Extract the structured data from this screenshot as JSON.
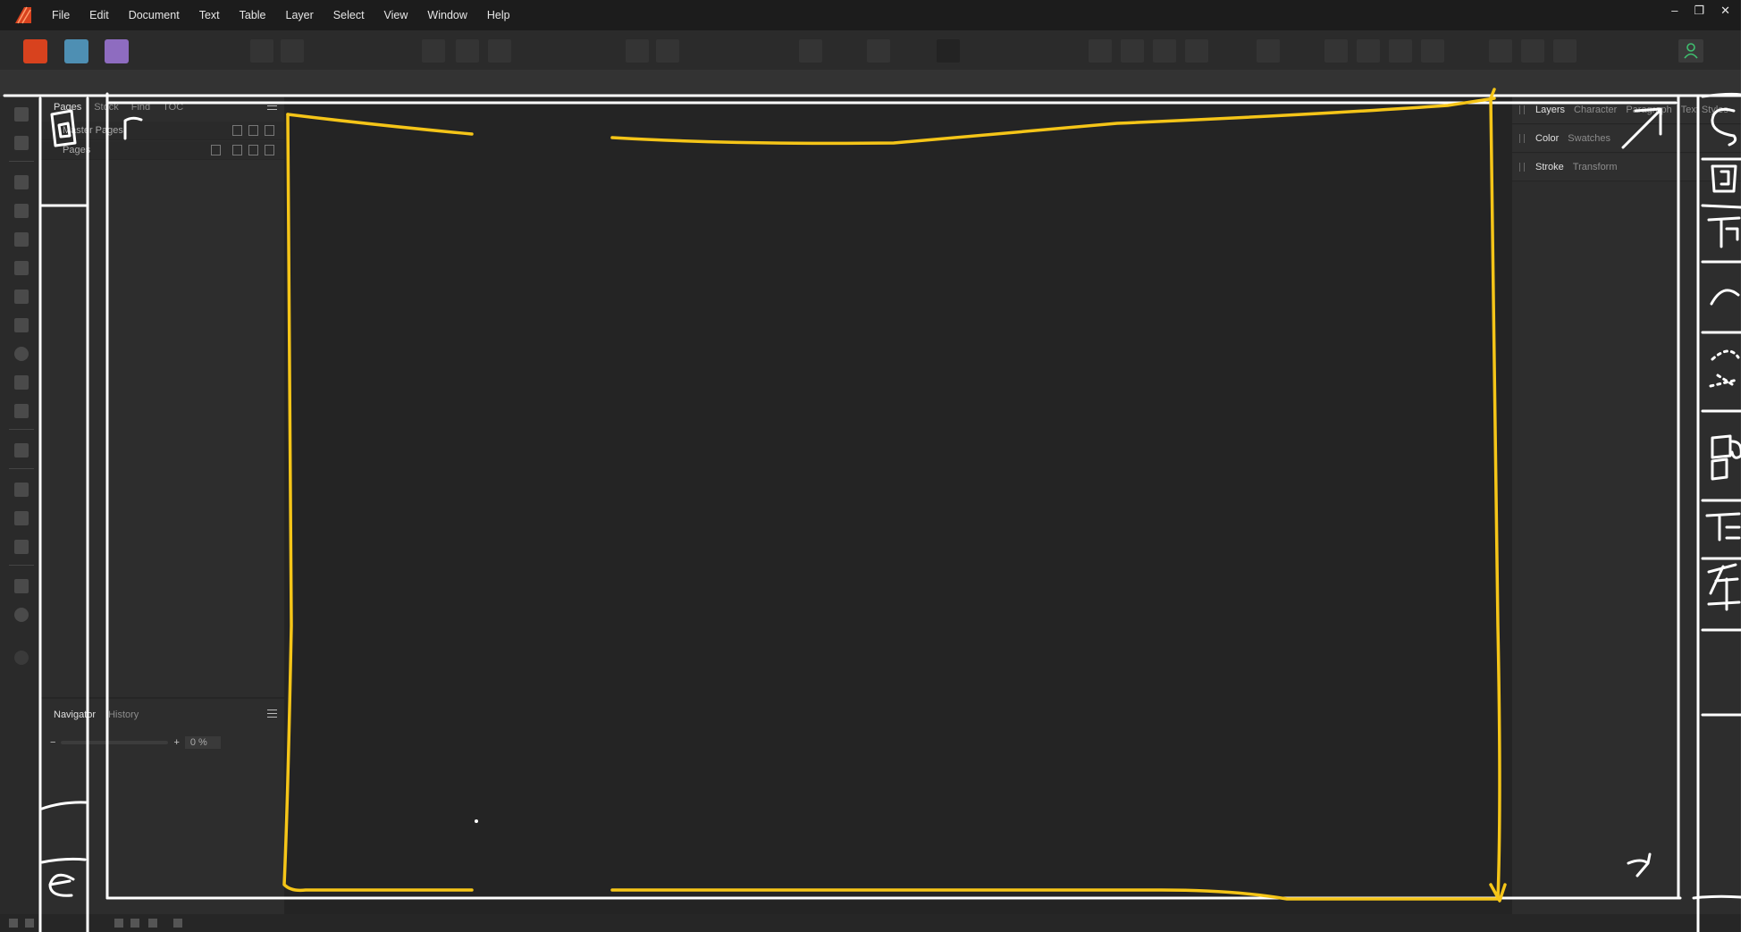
{
  "menubar": {
    "items": [
      "File",
      "Edit",
      "Document",
      "Text",
      "Table",
      "Layer",
      "Select",
      "View",
      "Window",
      "Help"
    ],
    "window_controls": {
      "minimize": "–",
      "restore": "❐",
      "close": "✕"
    }
  },
  "toolbar": {
    "personas": [
      {
        "name": "publisher-persona",
        "color": "#d8421e"
      },
      {
        "name": "designer-persona",
        "color": "#5fa3c7"
      },
      {
        "name": "photo-persona",
        "color": "#a77fd4"
      }
    ]
  },
  "left_panel": {
    "tabs": [
      "Pages",
      "Stock",
      "Find",
      "TOC"
    ],
    "master_pages_label": "Master Pages",
    "pages_label": "Pages"
  },
  "navigator": {
    "tabs": [
      "Navigator",
      "History"
    ],
    "zoom_minus": "−",
    "zoom_plus": "+",
    "zoom_value": "0 %"
  },
  "right_panel": {
    "row1": [
      "Layers",
      "Character",
      "Paragraph",
      "Text Styles"
    ],
    "row2": [
      "Color",
      "Swatches"
    ],
    "row3": [
      "Stroke",
      "Transform"
    ]
  },
  "colors": {
    "annotation_yellow": "#f5c518",
    "annotation_white": "#ffffff"
  }
}
